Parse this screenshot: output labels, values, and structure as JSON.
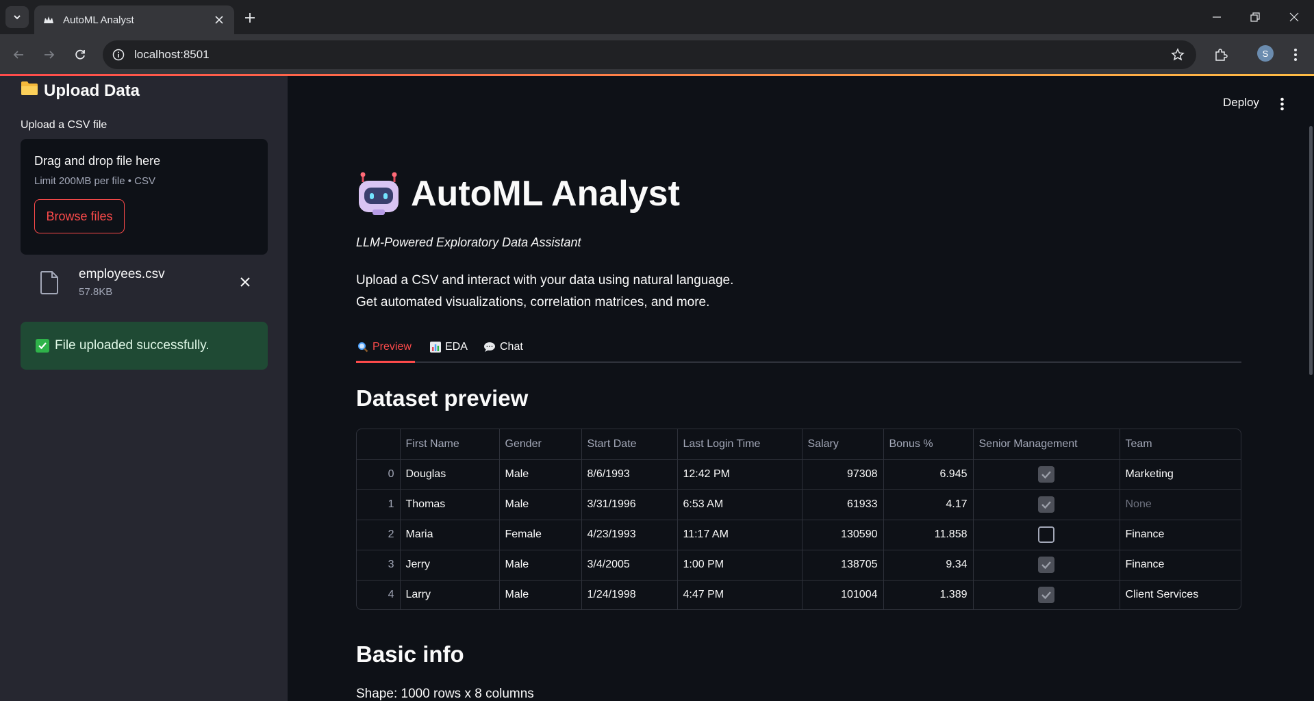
{
  "browser": {
    "tab_title": "AutoML Analyst",
    "url": "localhost:8501",
    "profile_initial": "S"
  },
  "colors": {
    "accent": "#ff4b4b",
    "sidebar_bg": "#262730",
    "main_bg": "#0e1117",
    "success_bg": "#1f4a34"
  },
  "sidebar": {
    "header": "Upload Data",
    "header_icon": "folder-icon",
    "uploader_label": "Upload a CSV file",
    "dropzone_title": "Drag and drop file here",
    "dropzone_limit": "Limit 200MB per file • CSV",
    "browse_label": "Browse files",
    "file_name": "employees.csv",
    "file_size": "57.8KB",
    "success_message": "File uploaded successfully."
  },
  "main": {
    "deploy_label": "Deploy",
    "title": "AutoML Analyst",
    "title_icon": "robot-icon",
    "subtitle": "LLM-Powered Exploratory Data Assistant",
    "intro_line1": "Upload a CSV and interact with your data using natural language.",
    "intro_line2": "Get automated visualizations, correlation matrices, and more.",
    "tabs": [
      {
        "label": "Preview",
        "icon": "magnifier-icon",
        "active": true
      },
      {
        "label": "EDA",
        "icon": "bar-chart-icon",
        "active": false
      },
      {
        "label": "Chat",
        "icon": "speech-bubble-icon",
        "active": false
      }
    ],
    "dataset_heading": "Dataset preview",
    "table": {
      "columns": [
        "",
        "First Name",
        "Gender",
        "Start Date",
        "Last Login Time",
        "Salary",
        "Bonus %",
        "Senior Management",
        "Team"
      ],
      "rows": [
        [
          "0",
          "Douglas",
          "Male",
          "8/6/1993",
          "12:42 PM",
          "97308",
          "6.945",
          true,
          "Marketing"
        ],
        [
          "1",
          "Thomas",
          "Male",
          "3/31/1996",
          "6:53 AM",
          "61933",
          "4.17",
          true,
          "None"
        ],
        [
          "2",
          "Maria",
          "Female",
          "4/23/1993",
          "11:17 AM",
          "130590",
          "11.858",
          false,
          "Finance"
        ],
        [
          "3",
          "Jerry",
          "Male",
          "3/4/2005",
          "1:00 PM",
          "138705",
          "9.34",
          true,
          "Finance"
        ],
        [
          "4",
          "Larry",
          "Male",
          "1/24/1998",
          "4:47 PM",
          "101004",
          "1.389",
          true,
          "Client Services"
        ]
      ]
    },
    "basic_heading": "Basic info",
    "shape_text": "Shape: 1000 rows x 8 columns"
  }
}
